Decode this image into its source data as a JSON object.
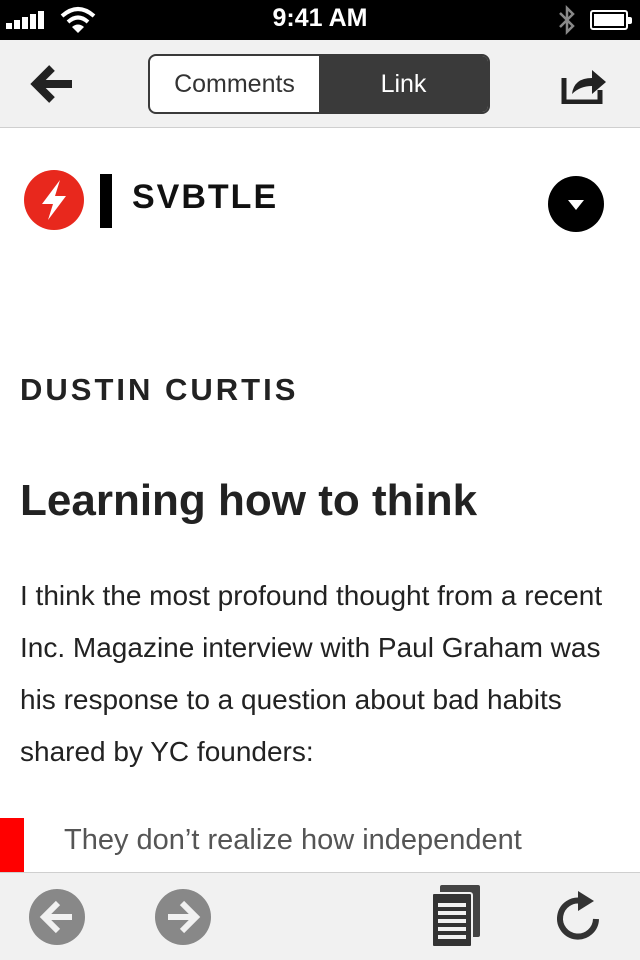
{
  "status_bar": {
    "time": "9:41 AM"
  },
  "nav": {
    "back_icon": "back-arrow-icon",
    "tabs": [
      {
        "label": "Comments",
        "selected": false
      },
      {
        "label": "Link",
        "selected": true
      }
    ],
    "share_icon": "share-icon"
  },
  "site": {
    "logo_icon": "lightning-icon",
    "name": "SVBTLE",
    "menu_icon": "chevron-down-icon",
    "brand_color": "#e8281d"
  },
  "article": {
    "author": "DUSTIN CURTIS",
    "title": "Learning how to think",
    "body": "I think the most profound thought from a recent Inc. Magazine interview with Paul Graham was his response to a question about bad habits shared by YC founders:",
    "quote": "They don’t realize how independent",
    "quote_color": "#ff0000"
  },
  "toolbar": {
    "icons": [
      "back-circle-icon",
      "forward-circle-icon",
      "reader-icon",
      "reload-icon"
    ]
  }
}
